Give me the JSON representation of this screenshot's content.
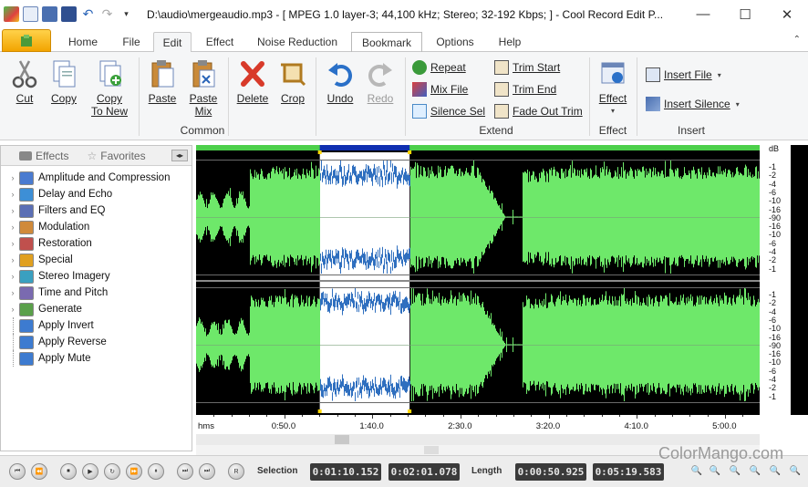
{
  "window": {
    "title": "D:\\audio\\mergeaudio.mp3 - [ MPEG 1.0 layer-3; 44,100 kHz; Stereo; 32-192 Kbps;  ] - Cool Record Edit P...",
    "minimize": "—",
    "maximize": "☐",
    "close": "✕"
  },
  "tabs": [
    "Home",
    "File",
    "Edit",
    "Effect",
    "Noise Reduction",
    "Bookmark",
    "Options",
    "Help"
  ],
  "ribbon_minimize": "⌃",
  "ribbon": {
    "common": {
      "label": "Common",
      "cut": "Cut",
      "copy": "Copy",
      "copy_to_new_1": "Copy",
      "copy_to_new_2": "To New",
      "paste": "Paste",
      "paste_mix_1": "Paste",
      "paste_mix_2": "Mix",
      "delete": "Delete",
      "crop": "Crop",
      "undo": "Undo",
      "redo": "Redo"
    },
    "extend": {
      "label": "Extend",
      "repeat": "Repeat",
      "mix_file": "Mix File",
      "silence_sel": "Silence Sel",
      "trim_start": "Trim Start",
      "trim_end": "Trim End",
      "fade_out_trim": "Fade Out Trim"
    },
    "effect": {
      "label": "Effect",
      "button": "Effect",
      "caret": "▾"
    },
    "insert": {
      "label": "Insert",
      "insert_file": "Insert File",
      "insert_silence": "Insert Silence",
      "caret": "▾"
    }
  },
  "left_panel": {
    "tab_effects": "Effects",
    "tab_favorites": "Favorites",
    "scroll_arrows": "◂▸",
    "tree": [
      {
        "label": "Amplitude and Compression",
        "expandable": true,
        "color": "#4a7bd0"
      },
      {
        "label": "Delay and Echo",
        "expandable": true,
        "color": "#3d8fd6"
      },
      {
        "label": "Filters and EQ",
        "expandable": true,
        "color": "#5b6fb5"
      },
      {
        "label": "Modulation",
        "expandable": true,
        "color": "#d08a3a"
      },
      {
        "label": "Restoration",
        "expandable": true,
        "color": "#c0504d"
      },
      {
        "label": "Special",
        "expandable": true,
        "color": "#e0a020"
      },
      {
        "label": "Stereo Imagery",
        "expandable": true,
        "color": "#3aa0c0"
      },
      {
        "label": "Time and Pitch",
        "expandable": true,
        "color": "#7a6ab0"
      },
      {
        "label": "Generate",
        "expandable": true,
        "color": "#5aa04a"
      },
      {
        "label": "Apply Invert",
        "expandable": false,
        "color": "#3d7bd0"
      },
      {
        "label": "Apply Reverse",
        "expandable": false,
        "color": "#3d7bd0"
      },
      {
        "label": "Apply Mute",
        "expandable": false,
        "color": "#3d7bd0"
      }
    ]
  },
  "db_scale": {
    "header": "dB",
    "ch1": [
      "-1",
      "-2",
      "-4",
      "-6",
      "-10",
      "-16",
      "-90",
      "-16",
      "-10",
      "-6",
      "-4",
      "-2",
      "-1"
    ],
    "ch2": [
      "-1",
      "-2",
      "-4",
      "-6",
      "-10",
      "-16",
      "-90",
      "-16",
      "-10",
      "-6",
      "-4",
      "-2",
      "-1"
    ]
  },
  "timeline": {
    "unit": "hms",
    "labels": [
      "0:50.0",
      "1:40.0",
      "2:30.0",
      "3:20.0",
      "4:10.0",
      "5:00.0"
    ]
  },
  "selection": {
    "start_s": 70.152,
    "end_s": 121.078,
    "total_s": 319.583
  },
  "bottom": {
    "transport": [
      "⏮",
      "⏪",
      "⏹",
      "▶",
      "↻",
      "⏩",
      "⏸",
      "⏭",
      "⏭",
      "R"
    ],
    "selection_label": "Selection",
    "selection_start": "0:01:10.152",
    "selection_end": "0:02:01.078",
    "length_label": "Length",
    "length": "0:00:50.925",
    "total": "0:05:19.583",
    "zoom": [
      "🔍",
      "🔍",
      "🔍",
      "🔍",
      "🔍",
      "🔍",
      "🔍"
    ]
  },
  "watermark": "ColorMango.com",
  "colors": {
    "waveform": "#6ee86a",
    "waveform_selected": "#2f6fbf",
    "selection_bg": "#ffffff",
    "background": "#000000",
    "file_tab": "#f2a400"
  }
}
